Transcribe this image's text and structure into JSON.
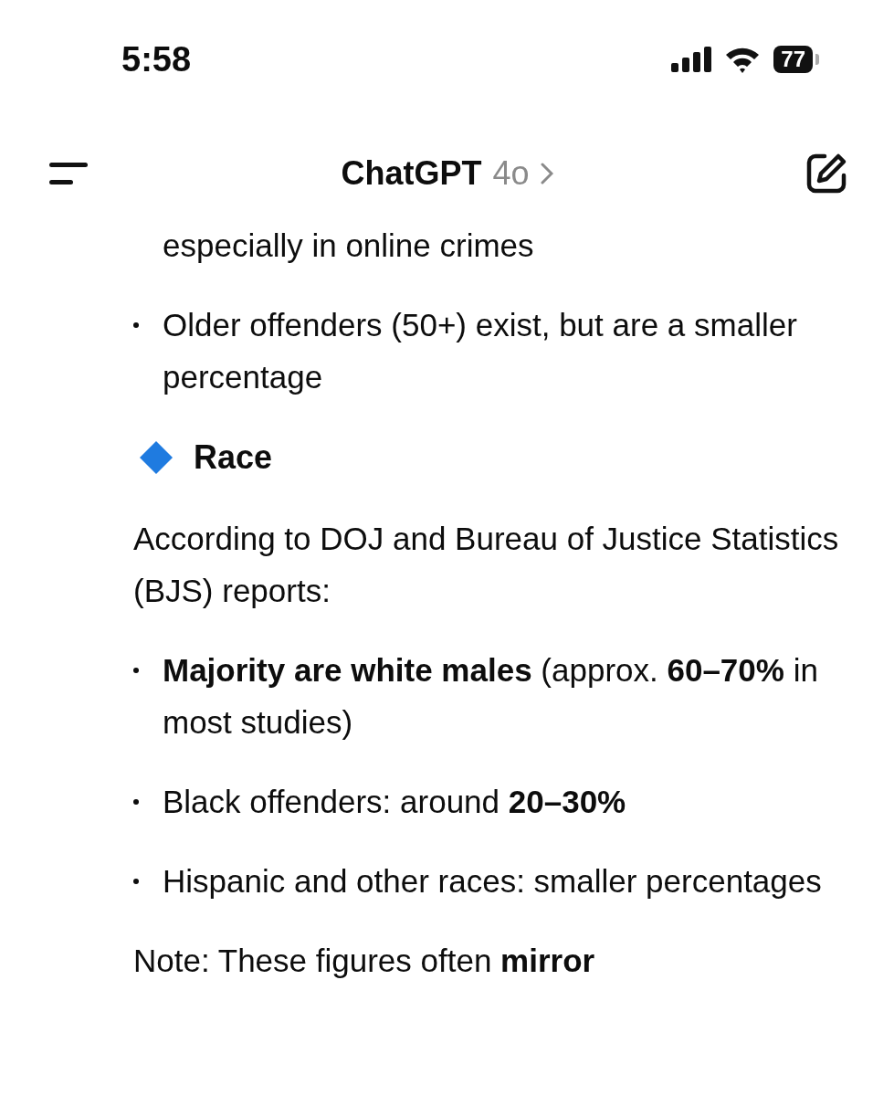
{
  "status_bar": {
    "time": "5:58",
    "battery": "77"
  },
  "header": {
    "title": "ChatGPT",
    "model": "4o"
  },
  "content": [
    {
      "kind": "bullet_continued",
      "text": "especially in online crimes"
    },
    {
      "kind": "bullet",
      "text": "Older offenders (50+) exist, but are a smaller percentage"
    },
    {
      "kind": "heading",
      "text": "Race"
    },
    {
      "kind": "paragraph",
      "text": "According to DOJ and Bureau of Justice Statistics (BJS) reports:"
    },
    {
      "kind": "bullet",
      "text": "**Majority are white males** (approx. **60–70%** in most studies)"
    },
    {
      "kind": "bullet",
      "text": "Black offenders: around **20–30%**"
    },
    {
      "kind": "bullet",
      "text": "Hispanic and other races: smaller percentages"
    },
    {
      "kind": "paragraph",
      "text": "Note: These figures often **mirror**"
    }
  ]
}
